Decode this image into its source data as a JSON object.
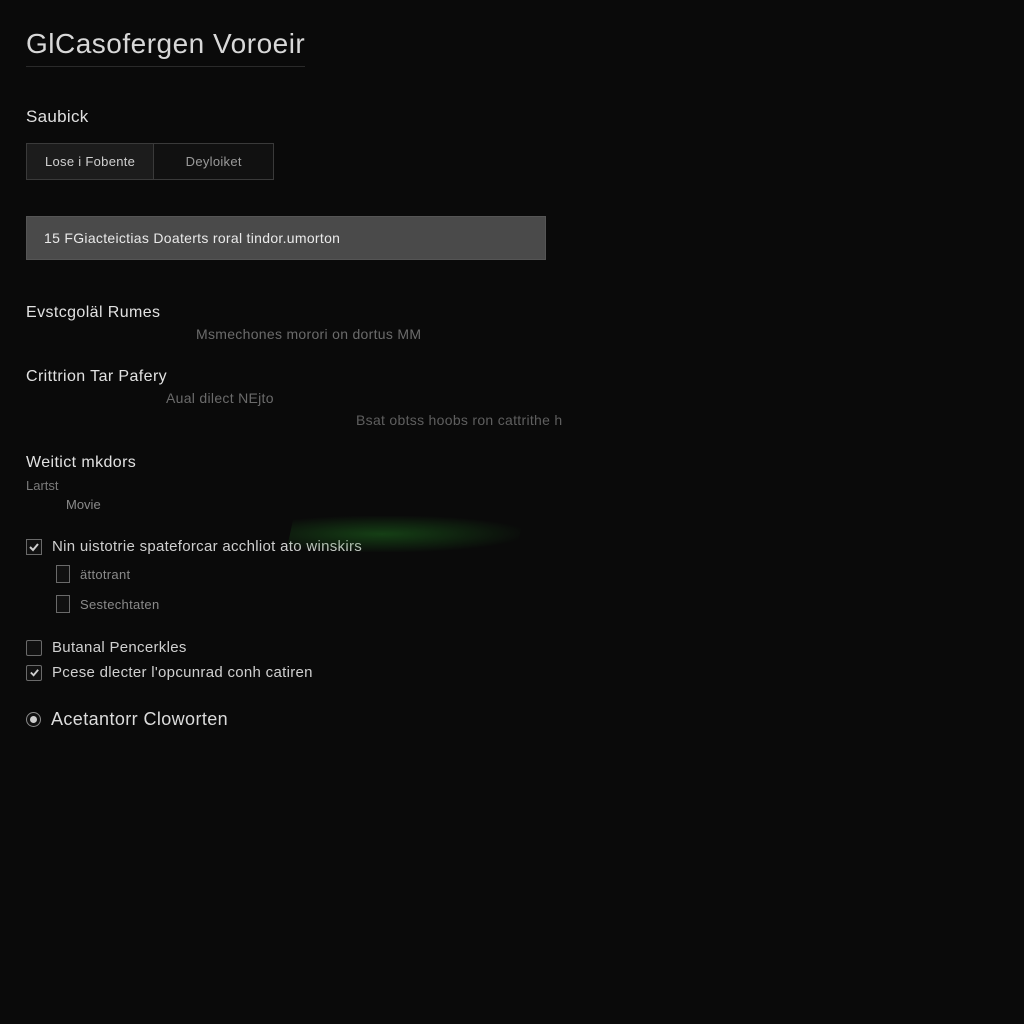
{
  "header": {
    "title": "GlCasofergen Voroeir"
  },
  "search": {
    "label": "Saubick"
  },
  "tabs": {
    "tab0": "Lose i Fobente",
    "tab1": "Deyloiket"
  },
  "banner": {
    "text": "15 FGiacteictias Doaterts roral tindor.umorton"
  },
  "fields": {
    "evs": {
      "label": "Evstcgoläl Rumes",
      "sub": "Msmechones morori on dortus MM"
    },
    "crit": {
      "label": "Crittrion Tar Pafery",
      "sub": "Aual  dilect  NEjto",
      "sub2": "Bsat obtss hoobs  ron cattrithe h"
    },
    "wei": {
      "label": "Weitict mkdors",
      "mini_label": "Lartst",
      "mini_val": "Movie"
    }
  },
  "checks": {
    "main": "Nin uistotrie spateforcar acchliot ato winskirs",
    "indent0": "ättotrant",
    "indent1": "Sestechtaten"
  },
  "group": {
    "item0": "Butanal Pencerkles",
    "item1": "Pcese dlecter l'opcunrad conh catiren"
  },
  "footer": {
    "label": "Acetantorr Cloworten"
  }
}
